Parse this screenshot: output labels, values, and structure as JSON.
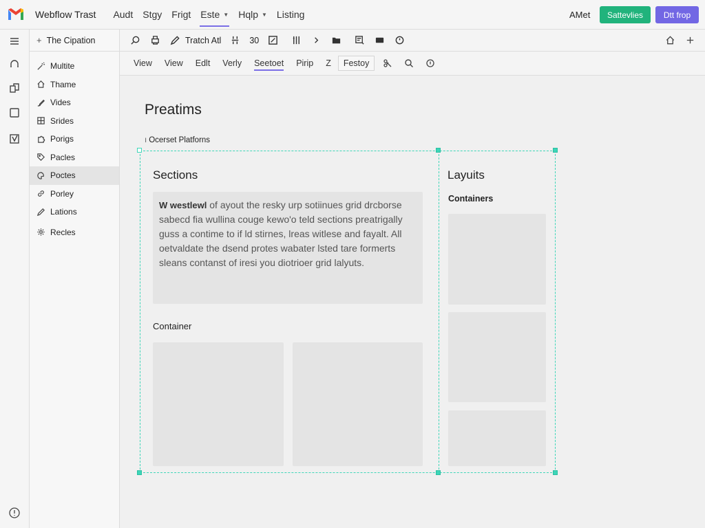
{
  "topbar": {
    "app_title": "Webflow Trast",
    "menu": [
      {
        "label": "Audt"
      },
      {
        "label": "Stgy"
      },
      {
        "label": "Frigt"
      },
      {
        "label": "Este"
      },
      {
        "label": "Hqlp"
      },
      {
        "label": "Listing"
      }
    ],
    "user": "AMet",
    "green_button": "Sattevlies",
    "purple_button": "Dtt frop",
    "accent_color": "#7a6ee6",
    "green_color": "#21b37c",
    "purple_color": "#7267e4"
  },
  "panel": {
    "header": "The Cipation",
    "items": [
      {
        "label": "Multite",
        "icon": "magic-icon"
      },
      {
        "label": "Thame",
        "icon": "home-icon"
      },
      {
        "label": "Vides",
        "icon": "brush-icon"
      },
      {
        "label": "Srides",
        "icon": "grid-icon"
      },
      {
        "label": "Porigs",
        "icon": "puzzle-icon"
      },
      {
        "label": "Pacles",
        "icon": "tag-icon"
      },
      {
        "label": "Poctes",
        "icon": "palette-icon"
      },
      {
        "label": "Porley",
        "icon": "link-icon"
      },
      {
        "label": "Lations",
        "icon": "pen-icon"
      },
      {
        "label": "Recles",
        "icon": "gear-icon"
      }
    ]
  },
  "toolbar1": {
    "text_a": "Tratch Atl",
    "text_b": "30"
  },
  "toolbar2": {
    "tabs": [
      {
        "label": "View"
      },
      {
        "label": "View"
      },
      {
        "label": "Edlt"
      },
      {
        "label": "Verly"
      },
      {
        "label": "Seetoet"
      },
      {
        "label": "Pirip"
      },
      {
        "label": "Z"
      }
    ],
    "boxed": "Festoy"
  },
  "canvas": {
    "page_title": "Preatims",
    "breadcrumb": "Ocerset Platforns",
    "sections_title": "Sections",
    "body_lead": "W westlewl",
    "body_text": " of ayout the resky urp sotiinues grid drcborse sabecd fia wullina couge kewo'o teld sections preatrigally guss a contime  to if ld stirnes, lreas witlese and fayalt. All oetvaldate the dsend protes wabater lsted tare formerts sleans contanst of iresi you diotrioer grid lalyuts.",
    "container_title": "Container",
    "layouts_title": "Layuits",
    "containers_title": "Containers",
    "frame_color": "#3dd6b8"
  }
}
